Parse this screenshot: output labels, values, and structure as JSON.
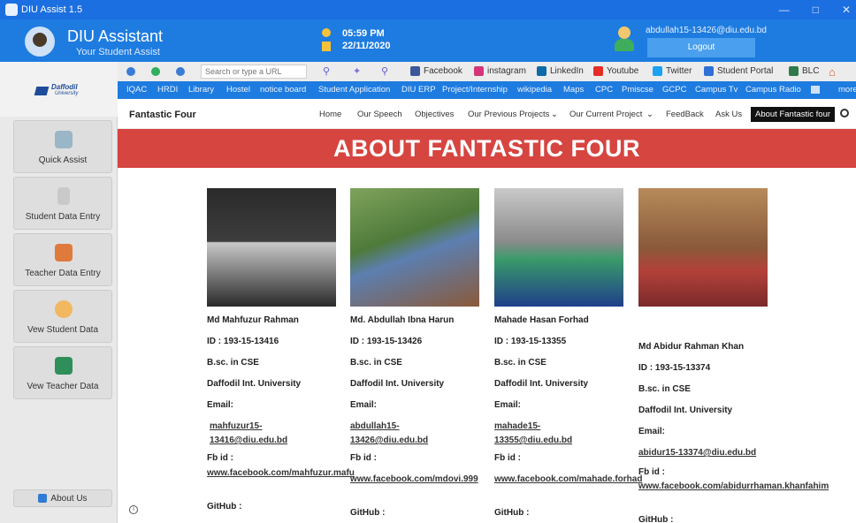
{
  "window": {
    "title": "DIU Assist 1.5"
  },
  "header": {
    "title": "DIU Assistant",
    "subtitle": "Your Student Assist",
    "time": "05:59 PM",
    "date": "22/11/2020",
    "user_email": "abdullah15-13426@diu.edu.bd",
    "logout_label": "Logout"
  },
  "sidebar": {
    "brand_name": "Daffodil",
    "brand_sub": "University",
    "items": [
      {
        "label": "Quick Assist"
      },
      {
        "label": "Student Data Entry"
      },
      {
        "label": "Teacher Data Entry"
      },
      {
        "label": "Vew Student Data"
      },
      {
        "label": "Vew Teacher Data"
      }
    ],
    "about_label": "About Us"
  },
  "browser": {
    "url_placeholder": "Search or type a URL",
    "bookmarks": [
      "Facebook",
      "instagram",
      "LinkedIn",
      "Youtube",
      "Twitter",
      "Student Portal",
      "BLC"
    ],
    "quicklinks": [
      "IQAC",
      "HRDI",
      "Library",
      "Hostel",
      "notice board",
      "Student Application",
      "DIU ERP",
      "Project/Internship",
      "wikipedia",
      "Maps",
      "CPC",
      "Pmiscse",
      "GCPC",
      "Campus Tv",
      "Campus Radio",
      "more"
    ]
  },
  "site": {
    "title": "Fantastic Four",
    "nav": [
      "Home",
      "Our Speech",
      "Objectives",
      "Our Previous Projects",
      "Our Current Project",
      "FeedBack",
      "Ask Us",
      "About Fantastic four"
    ],
    "banner": "ABOUT FANTASTIC FOUR",
    "members": [
      {
        "name": "Md Mahfuzur Rahman",
        "id": "ID : 193-15-13416",
        "degree": "B.sc. in CSE",
        "university": "Daffodil Int. University",
        "email_label": "Email:",
        "email": "mahfuzur15-13416@diu.edu.bd",
        "fb_label": "Fb id :",
        "fb": "www.facebook.com/mahfuzur.mafu",
        "github_label": "GitHub :"
      },
      {
        "name": "Md. Abdullah Ibna Harun",
        "id": "ID : 193-15-13426",
        "degree": "B.sc. in CSE",
        "university": "Daffodil Int. University",
        "email_label": "Email:",
        "email": "abdullah15-13426@diu.edu.bd",
        "fb_label": "Fb id :",
        "fb": "www.facebook.com/mdovi.999",
        "github_label": "GitHub :"
      },
      {
        "name": "Mahade Hasan Forhad",
        "id": "ID : 193-15-13355",
        "degree": "B.sc. in CSE",
        "university": "Daffodil Int. University",
        "email_label": "Email:",
        "email": "mahade15-13355@diu.edu.bd",
        "fb_label": "Fb id :",
        "fb": "www.facebook.com/mahade.forhad",
        "github_label": "GitHub :"
      },
      {
        "name": "Md Abidur Rahman Khan",
        "id": "ID : 193-15-13374",
        "degree": "B.sc. in CSE",
        "university": "Daffodil Int. University",
        "email_label": "Email:",
        "email": "abidur15-13374@diu.edu.bd",
        "fb_label": "Fb id :",
        "fb": "www.facebook.com/abidurrhaman.khanfahim",
        "github_label": "GitHub :"
      }
    ]
  },
  "colors": {
    "accent": "#1e7ce0",
    "banner": "#d64540"
  }
}
